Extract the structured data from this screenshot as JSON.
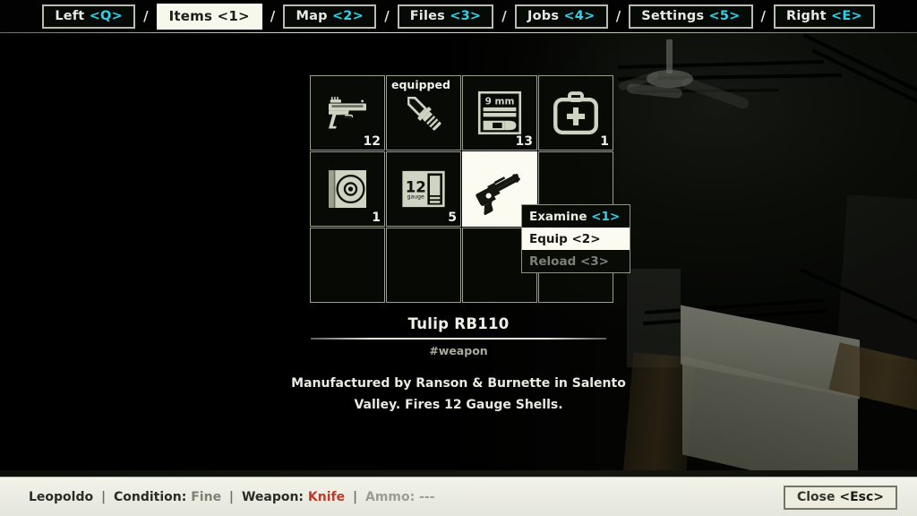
{
  "nav": {
    "separator": "/",
    "tabs": [
      {
        "label": "Left",
        "key": "<Q>",
        "active": false,
        "name": "tab-left"
      },
      {
        "label": "Items",
        "key": "<1>",
        "active": true,
        "name": "tab-items"
      },
      {
        "label": "Map",
        "key": "<2>",
        "active": false,
        "name": "tab-map"
      },
      {
        "label": "Files",
        "key": "<3>",
        "active": false,
        "name": "tab-files"
      },
      {
        "label": "Jobs",
        "key": "<4>",
        "active": false,
        "name": "tab-jobs"
      },
      {
        "label": "Settings",
        "key": "<5>",
        "active": false,
        "name": "tab-settings"
      },
      {
        "label": "Right",
        "key": "<E>",
        "active": false,
        "name": "tab-right"
      }
    ]
  },
  "inventory": {
    "columns": 4,
    "rows": 3,
    "slots": [
      {
        "icon": "pistol-icon",
        "name": "inventory-slot-pistol",
        "qty": "12",
        "badge": "",
        "selected": false,
        "empty": false
      },
      {
        "icon": "knife-icon",
        "name": "inventory-slot-knife",
        "qty": "",
        "badge": "equipped",
        "selected": false,
        "empty": false
      },
      {
        "icon": "ammo-9mm-icon",
        "name": "inventory-slot-9mm-ammo",
        "qty": "13",
        "badge": "",
        "selected": false,
        "empty": false,
        "box_label": "9 mm"
      },
      {
        "icon": "first-aid-icon",
        "name": "inventory-slot-first-aid",
        "qty": "1",
        "badge": "",
        "selected": false,
        "empty": false
      },
      {
        "icon": "disc-case-icon",
        "name": "inventory-slot-disc",
        "qty": "1",
        "badge": "",
        "selected": false,
        "empty": false
      },
      {
        "icon": "shells-12ga-icon",
        "name": "inventory-slot-12-gauge",
        "qty": "5",
        "badge": "",
        "selected": false,
        "empty": false,
        "box_label": "12",
        "box_sub": "gauge"
      },
      {
        "icon": "shotgun-icon",
        "name": "inventory-slot-shotgun",
        "qty": "",
        "badge": "",
        "selected": true,
        "empty": false
      },
      {
        "icon": "",
        "name": "inventory-slot-empty-8",
        "qty": "",
        "badge": "",
        "selected": false,
        "empty": true
      },
      {
        "icon": "",
        "name": "inventory-slot-empty-9",
        "qty": "",
        "badge": "",
        "selected": false,
        "empty": true
      },
      {
        "icon": "",
        "name": "inventory-slot-empty-10",
        "qty": "",
        "badge": "",
        "selected": false,
        "empty": true
      },
      {
        "icon": "",
        "name": "inventory-slot-empty-11",
        "qty": "",
        "badge": "",
        "selected": false,
        "empty": true
      },
      {
        "icon": "",
        "name": "inventory-slot-empty-12",
        "qty": "",
        "badge": "",
        "selected": false,
        "empty": true
      }
    ]
  },
  "context_menu": {
    "items": [
      {
        "label": "Examine",
        "key": "<1>",
        "state": "normal",
        "name": "context-menu-examine"
      },
      {
        "label": "Equip",
        "key": "<2>",
        "state": "highlighted",
        "name": "context-menu-equip"
      },
      {
        "label": "Reload",
        "key": "<3>",
        "state": "disabled",
        "name": "context-menu-reload"
      }
    ]
  },
  "description": {
    "title": "Tulip RB110",
    "tag": "#weapon",
    "body": "Manufactured by Ranson & Burnette in Salento Valley. Fires 12 Gauge Shells."
  },
  "status": {
    "character": "Leopoldo",
    "condition_label": "Condition:",
    "condition_value": "Fine",
    "weapon_label": "Weapon:",
    "weapon_value": "Knife",
    "ammo_label": "Ammo:",
    "ammo_value": "---",
    "pipe": "|",
    "close_label": "Close",
    "close_key": "<Esc>"
  },
  "colors": {
    "key_hint": "#2fd2e8",
    "weapon_value": "#c0392b",
    "active_tab_bg": "#f7f8ec",
    "panel_bg": "#000000",
    "slot_border": "#9aa08c",
    "status_bar_bg": "#f2f3ea"
  }
}
